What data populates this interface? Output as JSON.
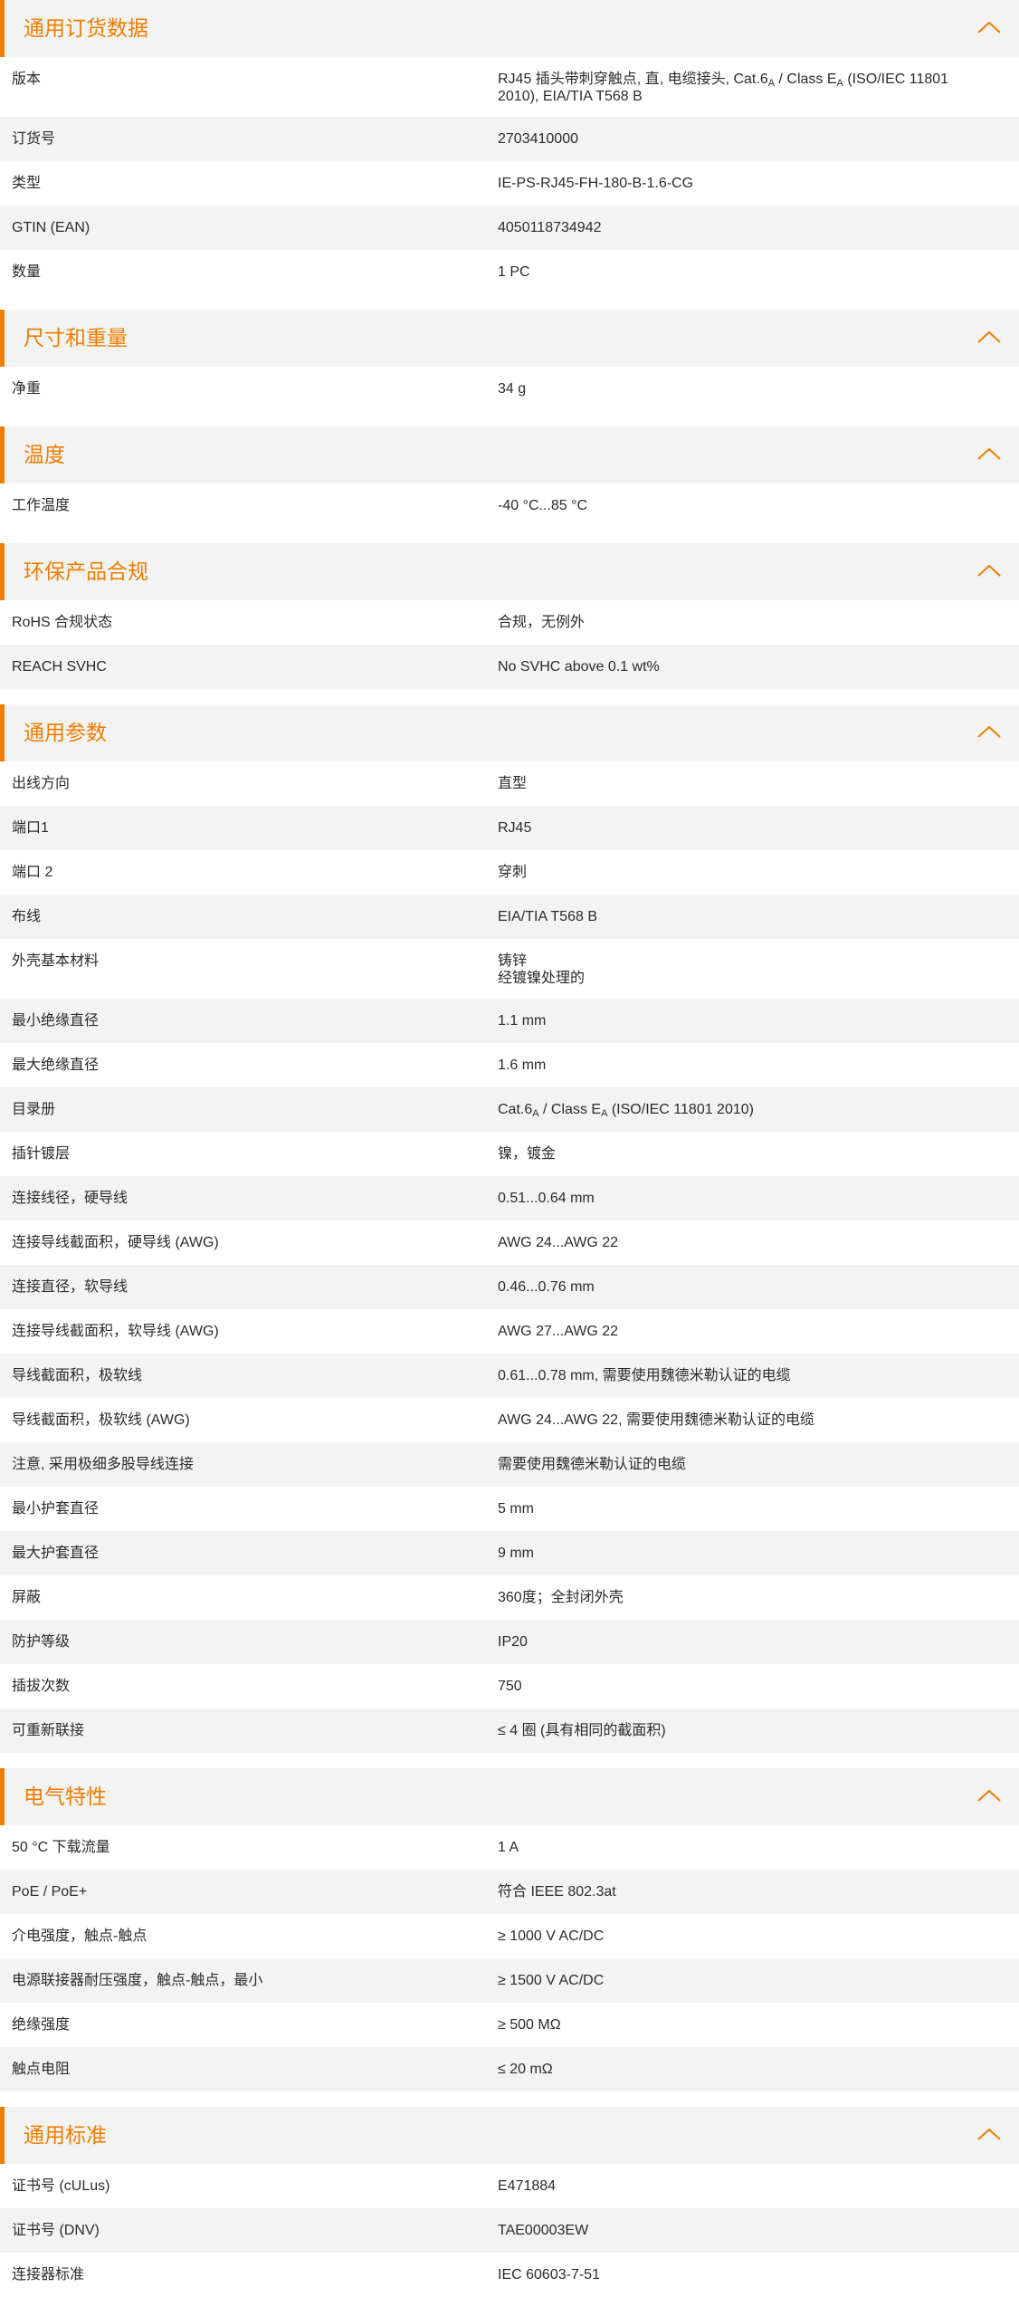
{
  "accent_color": "#f07d00",
  "header_background": "#f3f3f3",
  "collapse_icon": "chevron-up-icon",
  "sections": [
    {
      "title": "通用订货数据",
      "rows": [
        {
          "label": "版本",
          "lines": [
            [
              {
                "t": "RJ45 插头带刺穿触点, 直, 电缆接头, Cat.6"
              },
              {
                "s": "A"
              },
              {
                "t": " / Class E"
              },
              {
                "s": "A"
              },
              {
                "t": " (ISO/IEC 11801"
              }
            ],
            [
              {
                "t": "2010), EIA/TIA T568 B"
              }
            ]
          ]
        },
        {
          "label": "订货号",
          "lines": [
            [
              {
                "t": "2703410000"
              }
            ]
          ]
        },
        {
          "label": "类型",
          "lines": [
            [
              {
                "t": "IE-PS-RJ45-FH-180-B-1.6-CG"
              }
            ]
          ]
        },
        {
          "label": "GTIN (EAN)",
          "lines": [
            [
              {
                "t": "4050118734942"
              }
            ]
          ]
        },
        {
          "label": "数量",
          "lines": [
            [
              {
                "t": "1  PC"
              }
            ]
          ]
        }
      ]
    },
    {
      "title": "尺寸和重量",
      "rows": [
        {
          "label": "净重",
          "lines": [
            [
              {
                "t": "34  g"
              }
            ]
          ]
        }
      ]
    },
    {
      "title": "温度",
      "rows": [
        {
          "label": "工作温度",
          "lines": [
            [
              {
                "t": "-40 °C...85 °C"
              }
            ]
          ]
        }
      ]
    },
    {
      "title": "环保产品合规",
      "rows": [
        {
          "label": "RoHS 合规状态",
          "lines": [
            [
              {
                "t": "合规，无例外"
              }
            ]
          ]
        },
        {
          "label": "REACH SVHC",
          "lines": [
            [
              {
                "t": "No SVHC above 0.1 wt%"
              }
            ]
          ]
        }
      ]
    },
    {
      "title": "通用参数",
      "rows": [
        {
          "label": "出线方向",
          "lines": [
            [
              {
                "t": "直型"
              }
            ]
          ]
        },
        {
          "label": "端口1",
          "lines": [
            [
              {
                "t": "RJ45"
              }
            ]
          ]
        },
        {
          "label": "端口 2",
          "lines": [
            [
              {
                "t": "穿刺"
              }
            ]
          ]
        },
        {
          "label": "布线",
          "lines": [
            [
              {
                "t": "EIA/TIA T568 B"
              }
            ]
          ]
        },
        {
          "label": "外壳基本材料",
          "lines": [
            [
              {
                "t": "铸锌"
              }
            ],
            [
              {
                "t": "经镀镍处理的"
              }
            ]
          ]
        },
        {
          "label": "最小绝缘直径",
          "lines": [
            [
              {
                "t": "1.1  mm"
              }
            ]
          ]
        },
        {
          "label": "最大绝缘直径",
          "lines": [
            [
              {
                "t": "1.6  mm"
              }
            ]
          ]
        },
        {
          "label": "目录册",
          "lines": [
            [
              {
                "t": "Cat.6"
              },
              {
                "s": "A"
              },
              {
                "t": " / Class E"
              },
              {
                "s": "A"
              },
              {
                "t": " (ISO/IEC 11801 2010)"
              }
            ]
          ]
        },
        {
          "label": "插针镀层",
          "lines": [
            [
              {
                "t": "镍，镀金"
              }
            ]
          ]
        },
        {
          "label": "连接线径，硬导线",
          "lines": [
            [
              {
                "t": "0.51...0.64 mm"
              }
            ]
          ]
        },
        {
          "label": "连接导线截面积，硬导线 (AWG)",
          "lines": [
            [
              {
                "t": "AWG 24...AWG 22"
              }
            ]
          ]
        },
        {
          "label": "连接直径，软导线",
          "lines": [
            [
              {
                "t": "0.46...0.76 mm"
              }
            ]
          ]
        },
        {
          "label": "连接导线截面积，软导线 (AWG)",
          "lines": [
            [
              {
                "t": "AWG 27...AWG 22"
              }
            ]
          ]
        },
        {
          "label": "导线截面积，极软线",
          "lines": [
            [
              {
                "t": "0.61...0.78 mm, 需要使用魏德米勒认证的电缆"
              }
            ]
          ]
        },
        {
          "label": "导线截面积，极软线 (AWG)",
          "lines": [
            [
              {
                "t": "AWG 24...AWG 22, 需要使用魏德米勒认证的电缆"
              }
            ]
          ]
        },
        {
          "label": "注意, 采用极细多股导线连接",
          "lines": [
            [
              {
                "t": "需要使用魏德米勒认证的电缆"
              }
            ]
          ]
        },
        {
          "label": "最小护套直径",
          "lines": [
            [
              {
                "t": "5  mm"
              }
            ]
          ]
        },
        {
          "label": "最大护套直径",
          "lines": [
            [
              {
                "t": "9  mm"
              }
            ]
          ]
        },
        {
          "label": "屏蔽",
          "lines": [
            [
              {
                "t": "360度；全封闭外壳"
              }
            ]
          ]
        },
        {
          "label": "防护等级",
          "lines": [
            [
              {
                "t": "IP20"
              }
            ]
          ]
        },
        {
          "label": "插拔次数",
          "lines": [
            [
              {
                "t": "750"
              }
            ]
          ]
        },
        {
          "label": "可重新联接",
          "lines": [
            [
              {
                "t": "≤ 4 圈 (具有相同的截面积)"
              }
            ]
          ]
        }
      ]
    },
    {
      "title": "电气特性",
      "rows": [
        {
          "label": "50 °C 下载流量",
          "lines": [
            [
              {
                "t": "1  A"
              }
            ]
          ]
        },
        {
          "label": "PoE / PoE+",
          "lines": [
            [
              {
                "t": "符合 IEEE 802.3at"
              }
            ]
          ]
        },
        {
          "label": "介电强度，触点-触点",
          "lines": [
            [
              {
                "t": "≥ 1000 V AC/DC"
              }
            ]
          ]
        },
        {
          "label": "电源联接器耐压强度，触点-触点，最小",
          "lines": [
            [
              {
                "t": "≥ 1500 V AC/DC"
              }
            ]
          ]
        },
        {
          "label": "绝缘强度",
          "lines": [
            [
              {
                "t": "≥ 500 MΩ"
              }
            ]
          ]
        },
        {
          "label": "触点电阻",
          "lines": [
            [
              {
                "t": "≤ 20 mΩ"
              }
            ]
          ]
        }
      ]
    },
    {
      "title": "通用标准",
      "rows": [
        {
          "label": "证书号 (cULus)",
          "lines": [
            [
              {
                "t": "E471884"
              }
            ]
          ]
        },
        {
          "label": "证书号 (DNV)",
          "lines": [
            [
              {
                "t": "TAE00003EW"
              }
            ]
          ]
        },
        {
          "label": "连接器标准",
          "lines": [
            [
              {
                "t": "IEC 60603-7-51"
              }
            ]
          ]
        }
      ]
    }
  ]
}
